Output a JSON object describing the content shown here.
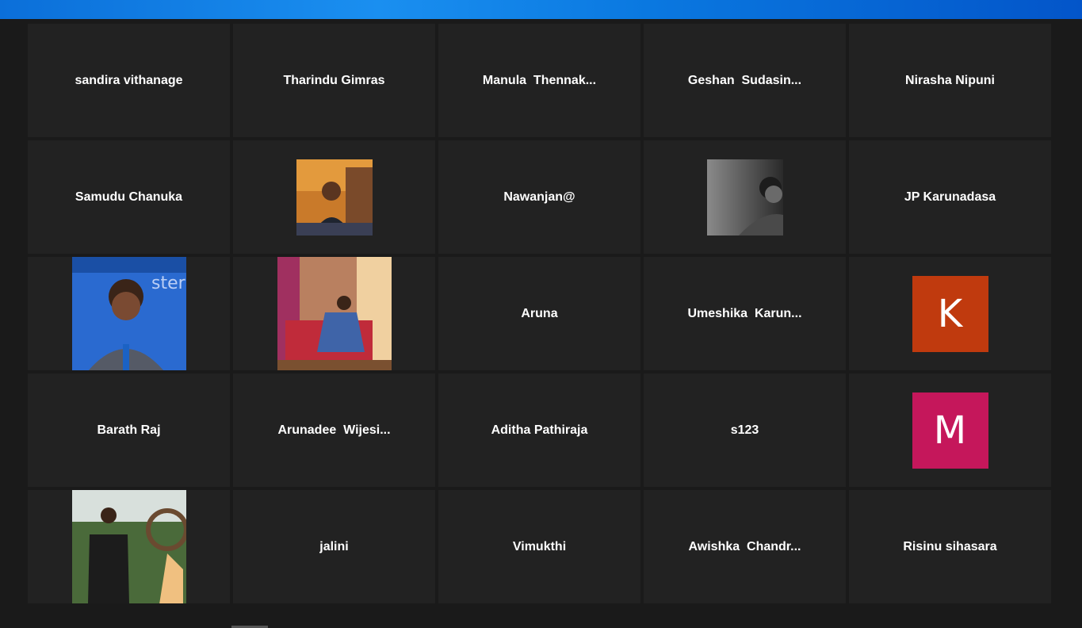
{
  "participants": [
    {
      "name": "sandira vithanage"
    },
    {
      "name": "Tharindu Gimras"
    },
    {
      "name": "Manula  Thennak..."
    },
    {
      "name": "Geshan  Sudasin..."
    },
    {
      "name": "Nirasha Nipuni"
    },
    {
      "name": "Samudu Chanuka"
    },
    {
      "name": "participant-photo-1"
    },
    {
      "name": "Nawanjan@"
    },
    {
      "name": "participant-photo-2"
    },
    {
      "name": "JP Karunadasa"
    },
    {
      "name": "participant-photo-3"
    },
    {
      "name": "participant-photo-4"
    },
    {
      "name": "Aruna"
    },
    {
      "name": "Umeshika  Karun..."
    },
    {
      "name": "K",
      "color": "#c03a0e"
    },
    {
      "name": "Barath Raj"
    },
    {
      "name": "Arunadee  Wijesi..."
    },
    {
      "name": "Aditha Pathiraja"
    },
    {
      "name": "s123"
    },
    {
      "name": "M",
      "color": "#c5175b"
    },
    {
      "name": "participant-photo-5"
    },
    {
      "name": "jalini"
    },
    {
      "name": "Vimukthi"
    },
    {
      "name": "Awishka  Chandr..."
    },
    {
      "name": "Risinu sihasara"
    }
  ]
}
